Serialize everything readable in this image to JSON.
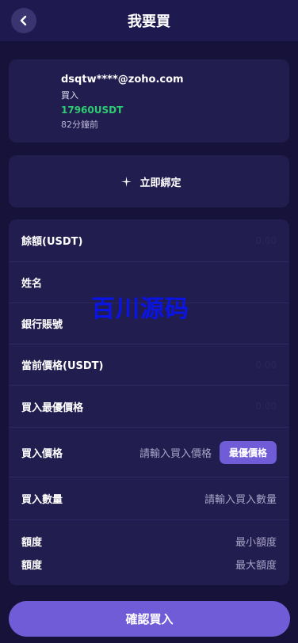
{
  "header": {
    "title": "我要買",
    "back_icon": "chevron-left-icon"
  },
  "order": {
    "email": "dsqtw****@zoho.com",
    "type": "買入",
    "amount": "17960USDT",
    "time": "82分鐘前"
  },
  "bind": {
    "icon": "sparkle-icon",
    "label": "立即綁定"
  },
  "form": {
    "balance_label": "餘額(USDT)",
    "balance_value": "0.00",
    "name_label": "姓名",
    "bank_label": "銀行賬號",
    "current_price_label": "當前價格(USDT)",
    "current_price_value": "0.00",
    "best_price_label": "買入最優價格",
    "best_price_value": "0.00",
    "buy_price_label": "買入價格",
    "buy_price_placeholder": "請輸入買入價格",
    "best_price_button": "最優價格",
    "buy_qty_label": "買入數量",
    "buy_qty_placeholder": "請輸入買入數量",
    "min_label": "額度",
    "min_placeholder": "最小額度",
    "max_label": "額度",
    "max_placeholder": "最大額度"
  },
  "watermark": "百川源码",
  "confirm_button": "確認買入",
  "colors": {
    "background": "#16123a",
    "card": "#221d4f",
    "accent": "#6f5cd6",
    "green": "#2ecc71"
  }
}
